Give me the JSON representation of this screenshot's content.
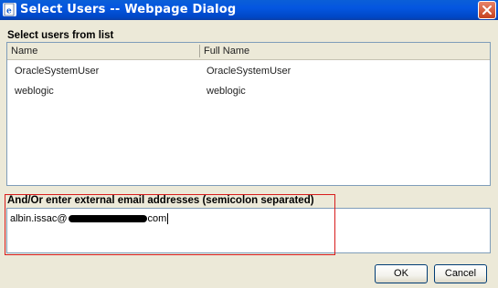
{
  "window": {
    "title": "Select Users -- Webpage Dialog"
  },
  "users_section": {
    "label": "Select users from list",
    "columns": [
      "Name",
      "Full Name"
    ],
    "rows": [
      {
        "name": "OracleSystemUser",
        "full_name": "OracleSystemUser"
      },
      {
        "name": "weblogic",
        "full_name": "weblogic"
      }
    ]
  },
  "email_section": {
    "label": "And/Or enter external email addresses (semicolon separated)",
    "value_prefix": "albin.issac@",
    "value_suffix": "com"
  },
  "buttons": {
    "ok": "OK",
    "cancel": "Cancel"
  },
  "icons": {
    "window": "ie-page-icon",
    "close": "close-icon"
  },
  "colors": {
    "titlebar": "#0456e0",
    "dialog_bg": "#ece9d8",
    "highlight": "#d81c1c"
  }
}
